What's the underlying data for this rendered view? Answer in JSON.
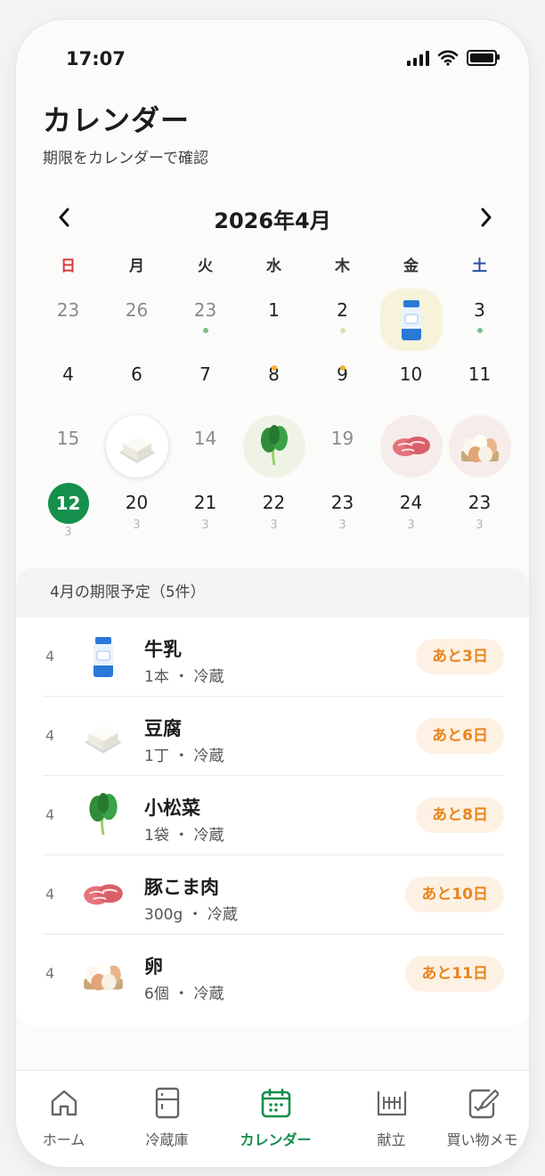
{
  "status": {
    "time": "17:07"
  },
  "header": {
    "title": "カレンダー",
    "subtitle": "期限をカレンダーで確認"
  },
  "calendar": {
    "month_label": "2026年4月",
    "prev_icon": "chevron-left-icon",
    "next_icon": "chevron-right-icon",
    "weekdays": [
      "日",
      "月",
      "火",
      "水",
      "木",
      "金",
      "土"
    ],
    "rows": [
      [
        "23",
        "26",
        "23",
        "1",
        "2",
        "",
        "3"
      ],
      [
        "4",
        "6",
        "7",
        "8",
        "9",
        "10",
        "11"
      ],
      [
        "15",
        "",
        "14",
        "",
        "19",
        "",
        ""
      ],
      [
        "12",
        "20",
        "21",
        "22",
        "23",
        "24",
        "23"
      ]
    ],
    "last_row_subs": [
      "3",
      "3",
      "3",
      "3",
      "3",
      "3",
      "3"
    ],
    "today": "12"
  },
  "list": {
    "header": "4月の期限予定（5件）",
    "items": [
      {
        "month": "4",
        "icon": "milk-icon",
        "name": "牛乳",
        "meta": "1本 ・ 冷蔵",
        "badge": "あと3日"
      },
      {
        "month": "4",
        "icon": "tofu-icon",
        "name": "豆腐",
        "meta": "1丁 ・ 冷蔵",
        "badge": "あと6日"
      },
      {
        "month": "4",
        "icon": "komatsuna-icon",
        "name": "小松菜",
        "meta": "1袋 ・ 冷蔵",
        "badge": "あと8日"
      },
      {
        "month": "4",
        "icon": "pork-icon",
        "name": "豚こま肉",
        "meta": "300g ・ 冷蔵",
        "badge": "あと10日"
      },
      {
        "month": "4",
        "icon": "eggs-icon",
        "name": "卵",
        "meta": "6個 ・ 冷蔵",
        "badge": "あと11日"
      }
    ]
  },
  "tabs": [
    {
      "label": "ホーム",
      "icon": "home-icon"
    },
    {
      "label": "冷蔵庫",
      "icon": "fridge-icon"
    },
    {
      "label": "カレンダー",
      "icon": "calendar-icon",
      "active": true
    },
    {
      "label": "献立",
      "icon": "menu-icon"
    },
    {
      "label": "買い物メモ",
      "icon": "shopping-memo-icon"
    }
  ],
  "colors": {
    "accent": "#148f4c",
    "badge_text": "#e9851c",
    "badge_bg": "#fdf1e4",
    "sunday": "#d63a3a",
    "saturday": "#2f4fa8"
  }
}
